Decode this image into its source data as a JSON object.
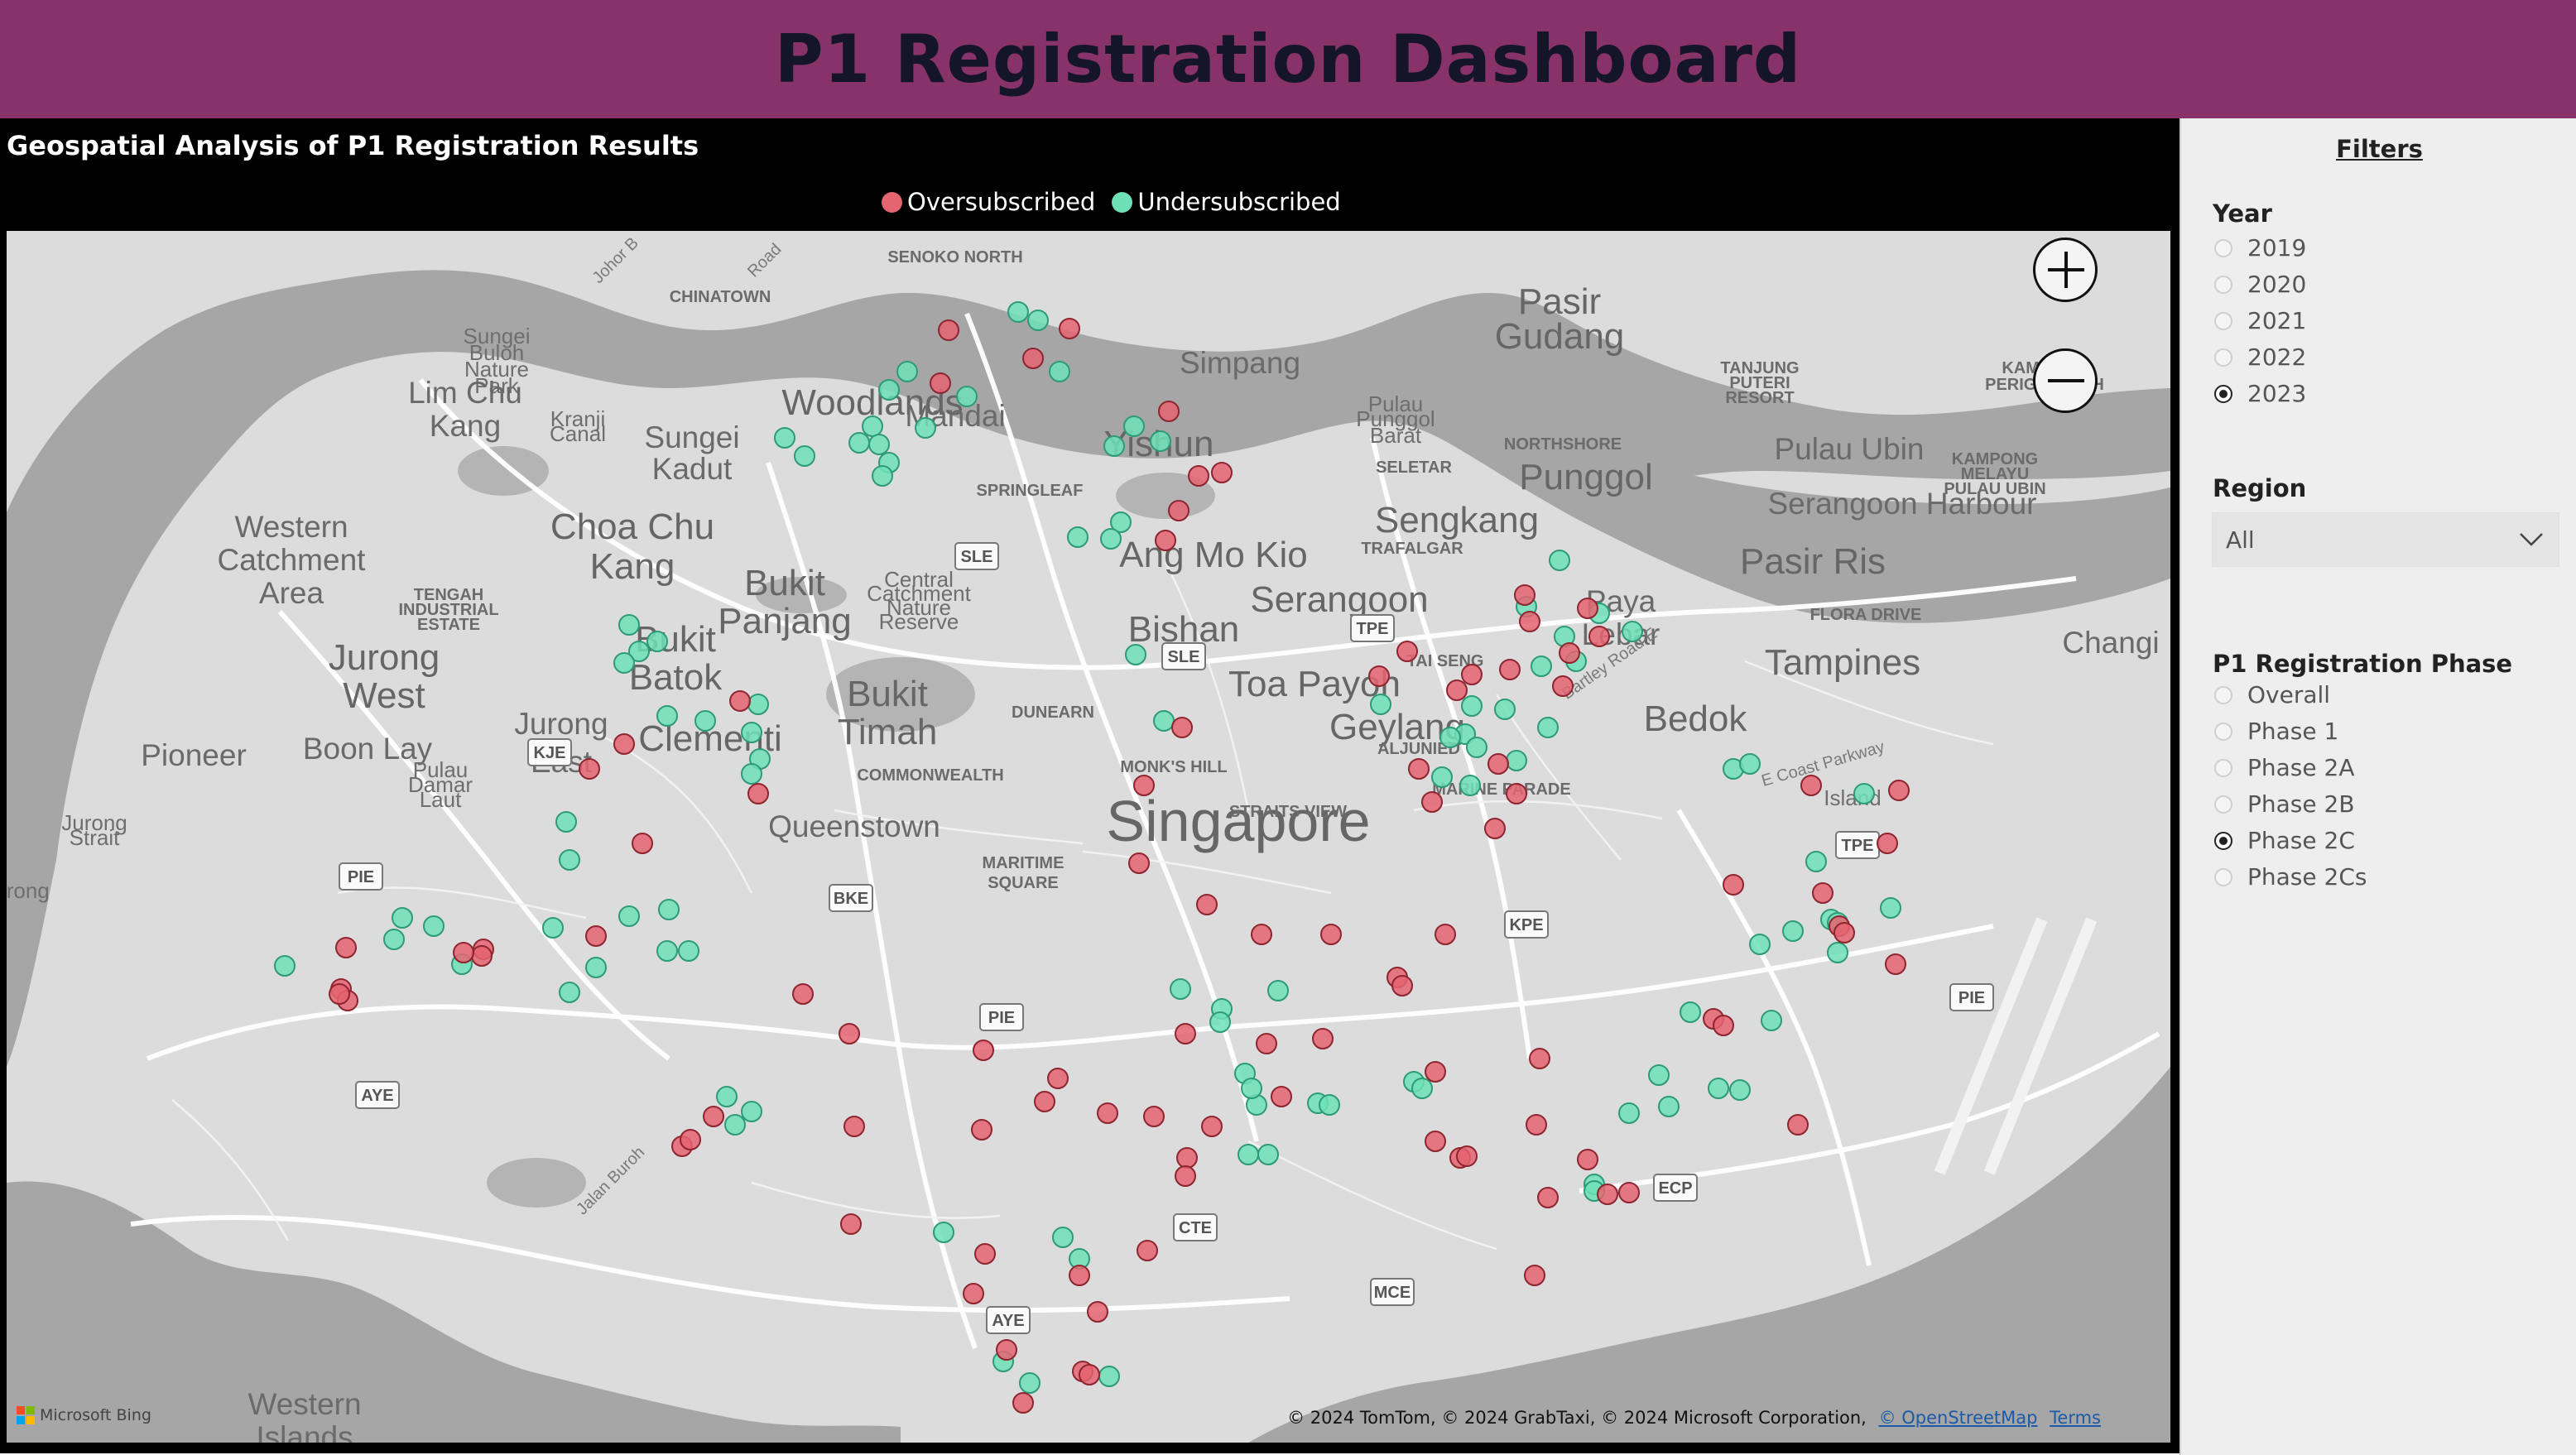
{
  "header": {
    "title": "P1 Registration Dashboard"
  },
  "visual": {
    "title": "Geospatial Analysis of P1 Registration Results",
    "legend": [
      {
        "label": "Oversubscribed",
        "color": "#e46470"
      },
      {
        "label": "Undersubscribed",
        "color": "#6ee0b8"
      }
    ]
  },
  "map": {
    "zoom_in_icon": "plus-icon",
    "zoom_out_icon": "minus-icon",
    "bing_label": "Microsoft Bing",
    "attribution": "© 2024 TomTom, © 2024 GrabTaxi, © 2024 Microsoft Corporation,",
    "osm_link": "© OpenStreetMap",
    "terms_link": "Terms",
    "place_labels": [
      {
        "text": "SENOKO NORTH",
        "cls": "small"
      },
      {
        "text": "CHINATOWN",
        "cls": "small"
      },
      {
        "text": "Woodlands",
        "cls": "big"
      },
      {
        "text": "Simpang",
        "cls": "mid"
      },
      {
        "text": "Pasir",
        "cls": "big"
      },
      {
        "text": "Gudang",
        "cls": "big"
      },
      {
        "text": "TANJUNG",
        "cls": "small"
      },
      {
        "text": "PUTERI",
        "cls": "small"
      },
      {
        "text": "RESORT",
        "cls": "small"
      },
      {
        "text": "KAMPUNG",
        "cls": "small"
      },
      {
        "text": "PERIGI ACHEH",
        "cls": "small"
      },
      {
        "text": "Sungei",
        "cls": "tiny"
      },
      {
        "text": "Buloh",
        "cls": "tiny"
      },
      {
        "text": "Nature",
        "cls": "tiny"
      },
      {
        "text": "Park",
        "cls": "tiny"
      },
      {
        "text": "Lim Chu",
        "cls": "mid"
      },
      {
        "text": "Kang",
        "cls": "mid"
      },
      {
        "text": "Kranji",
        "cls": "tiny"
      },
      {
        "text": "Canal",
        "cls": "tiny"
      },
      {
        "text": "Mandai",
        "cls": "mid"
      },
      {
        "text": "Pulau",
        "cls": "tiny"
      },
      {
        "text": "Punggol",
        "cls": "tiny"
      },
      {
        "text": "Barat",
        "cls": "tiny"
      },
      {
        "text": "Sungei",
        "cls": "mid"
      },
      {
        "text": "Kadut",
        "cls": "mid"
      },
      {
        "text": "Yishun",
        "cls": "big"
      },
      {
        "text": "Pulau Ubin",
        "cls": "mid"
      },
      {
        "text": "KAMPONG",
        "cls": "small"
      },
      {
        "text": "MELAYU",
        "cls": "small"
      },
      {
        "text": "NORTHSHORE",
        "cls": "small"
      },
      {
        "text": "Punggol",
        "cls": "big"
      },
      {
        "text": "SELETAR",
        "cls": "small"
      },
      {
        "text": "PULAU UBIN",
        "cls": "small"
      },
      {
        "text": "Serangoon Harbour",
        "cls": "mid"
      },
      {
        "text": "SPRINGLEAF",
        "cls": "small"
      },
      {
        "text": "Western",
        "cls": "mid"
      },
      {
        "text": "Catchment",
        "cls": "mid"
      },
      {
        "text": "Area",
        "cls": "mid"
      },
      {
        "text": "Choa Chu",
        "cls": "big"
      },
      {
        "text": "Kang",
        "cls": "big"
      },
      {
        "text": "Sengkang",
        "cls": "big"
      },
      {
        "text": "Ang Mo Kio",
        "cls": "big"
      },
      {
        "text": "TRAFALGAR",
        "cls": "small"
      },
      {
        "text": "Pasir Ris",
        "cls": "big"
      },
      {
        "text": "TENGAH",
        "cls": "small"
      },
      {
        "text": "INDUSTRIAL",
        "cls": "small"
      },
      {
        "text": "ESTATE",
        "cls": "small"
      },
      {
        "text": "Bukit",
        "cls": "big"
      },
      {
        "text": "Panjang",
        "cls": "big"
      },
      {
        "text": "Central",
        "cls": "tiny"
      },
      {
        "text": "Catchment",
        "cls": "tiny"
      },
      {
        "text": "Nature",
        "cls": "tiny"
      },
      {
        "text": "Reserve",
        "cls": "tiny"
      },
      {
        "text": "Serangoon",
        "cls": "big"
      },
      {
        "text": "Paya",
        "cls": "mid"
      },
      {
        "text": "Lebar",
        "cls": "mid"
      },
      {
        "text": "FLORA DRIVE",
        "cls": "small"
      },
      {
        "text": "Bishan",
        "cls": "big"
      },
      {
        "text": "Changi",
        "cls": "mid"
      },
      {
        "text": "Jurong",
        "cls": "big"
      },
      {
        "text": "West",
        "cls": "big"
      },
      {
        "text": "Bukit",
        "cls": "big"
      },
      {
        "text": "Batok",
        "cls": "big"
      },
      {
        "text": "TAI SENG",
        "cls": "small"
      },
      {
        "text": "Tampines",
        "cls": "big"
      },
      {
        "text": "Bartley Road E",
        "cls": "road"
      },
      {
        "text": "Bukit",
        "cls": "big"
      },
      {
        "text": "Timah",
        "cls": "big"
      },
      {
        "text": "Toa Payoh",
        "cls": "big"
      },
      {
        "text": "DUNEARN",
        "cls": "small"
      },
      {
        "text": "Jurong",
        "cls": "mid"
      },
      {
        "text": "East",
        "cls": "mid"
      },
      {
        "text": "Geylang",
        "cls": "big"
      },
      {
        "text": "Bedok",
        "cls": "big"
      },
      {
        "text": "Pioneer",
        "cls": "mid"
      },
      {
        "text": "Boon Lay",
        "cls": "mid"
      },
      {
        "text": "Clementi",
        "cls": "big"
      },
      {
        "text": "ALJUNIED",
        "cls": "small"
      },
      {
        "text": "E Coast Parkway",
        "cls": "road"
      },
      {
        "text": "Pulau",
        "cls": "tiny"
      },
      {
        "text": "Damar",
        "cls": "tiny"
      },
      {
        "text": "Laut",
        "cls": "tiny"
      },
      {
        "text": "MONK'S HILL",
        "cls": "small"
      },
      {
        "text": "COMMONWEALTH",
        "cls": "small"
      },
      {
        "text": "MARINE PARADE",
        "cls": "small"
      },
      {
        "text": "Queenstown",
        "cls": "mid"
      },
      {
        "text": "Singapore",
        "cls": "huge"
      },
      {
        "text": "Jurong",
        "cls": "tiny"
      },
      {
        "text": "Strait",
        "cls": "tiny"
      },
      {
        "text": "STRAITS VIEW",
        "cls": "small"
      },
      {
        "text": "MARITIME",
        "cls": "small"
      },
      {
        "text": "SQUARE",
        "cls": "small"
      },
      {
        "text": "Jurong",
        "cls": "tiny"
      },
      {
        "text": "Island",
        "cls": "tiny"
      },
      {
        "text": "Western",
        "cls": "mid"
      },
      {
        "text": "Islands",
        "cls": "mid"
      },
      {
        "text": "Johor B",
        "cls": "road"
      },
      {
        "text": "Road",
        "cls": "road"
      },
      {
        "text": "Jalan Buroh",
        "cls": "road"
      }
    ],
    "road_shields": [
      "SLE",
      "SLE",
      "TPE",
      "KJE",
      "PIE",
      "BKE",
      "KPE",
      "TPE",
      "PIE",
      "AYE",
      "PIE",
      "CTE",
      "ECP",
      "MCE",
      "AYE"
    ],
    "oversubscribed_count": 99,
    "undersubscribed_count": 86
  },
  "filters": {
    "title": "Filters",
    "year": {
      "label": "Year",
      "options": [
        "2019",
        "2020",
        "2021",
        "2022",
        "2023"
      ],
      "selected": "2023"
    },
    "region": {
      "label": "Region",
      "value": "All",
      "icon": "chevron-down-icon"
    },
    "phase": {
      "label": "P1 Registration Phase",
      "options": [
        "Overall",
        "Phase 1",
        "Phase 2A",
        "Phase 2B",
        "Phase 2C",
        "Phase 2Cs"
      ],
      "selected": "Phase 2C"
    }
  }
}
